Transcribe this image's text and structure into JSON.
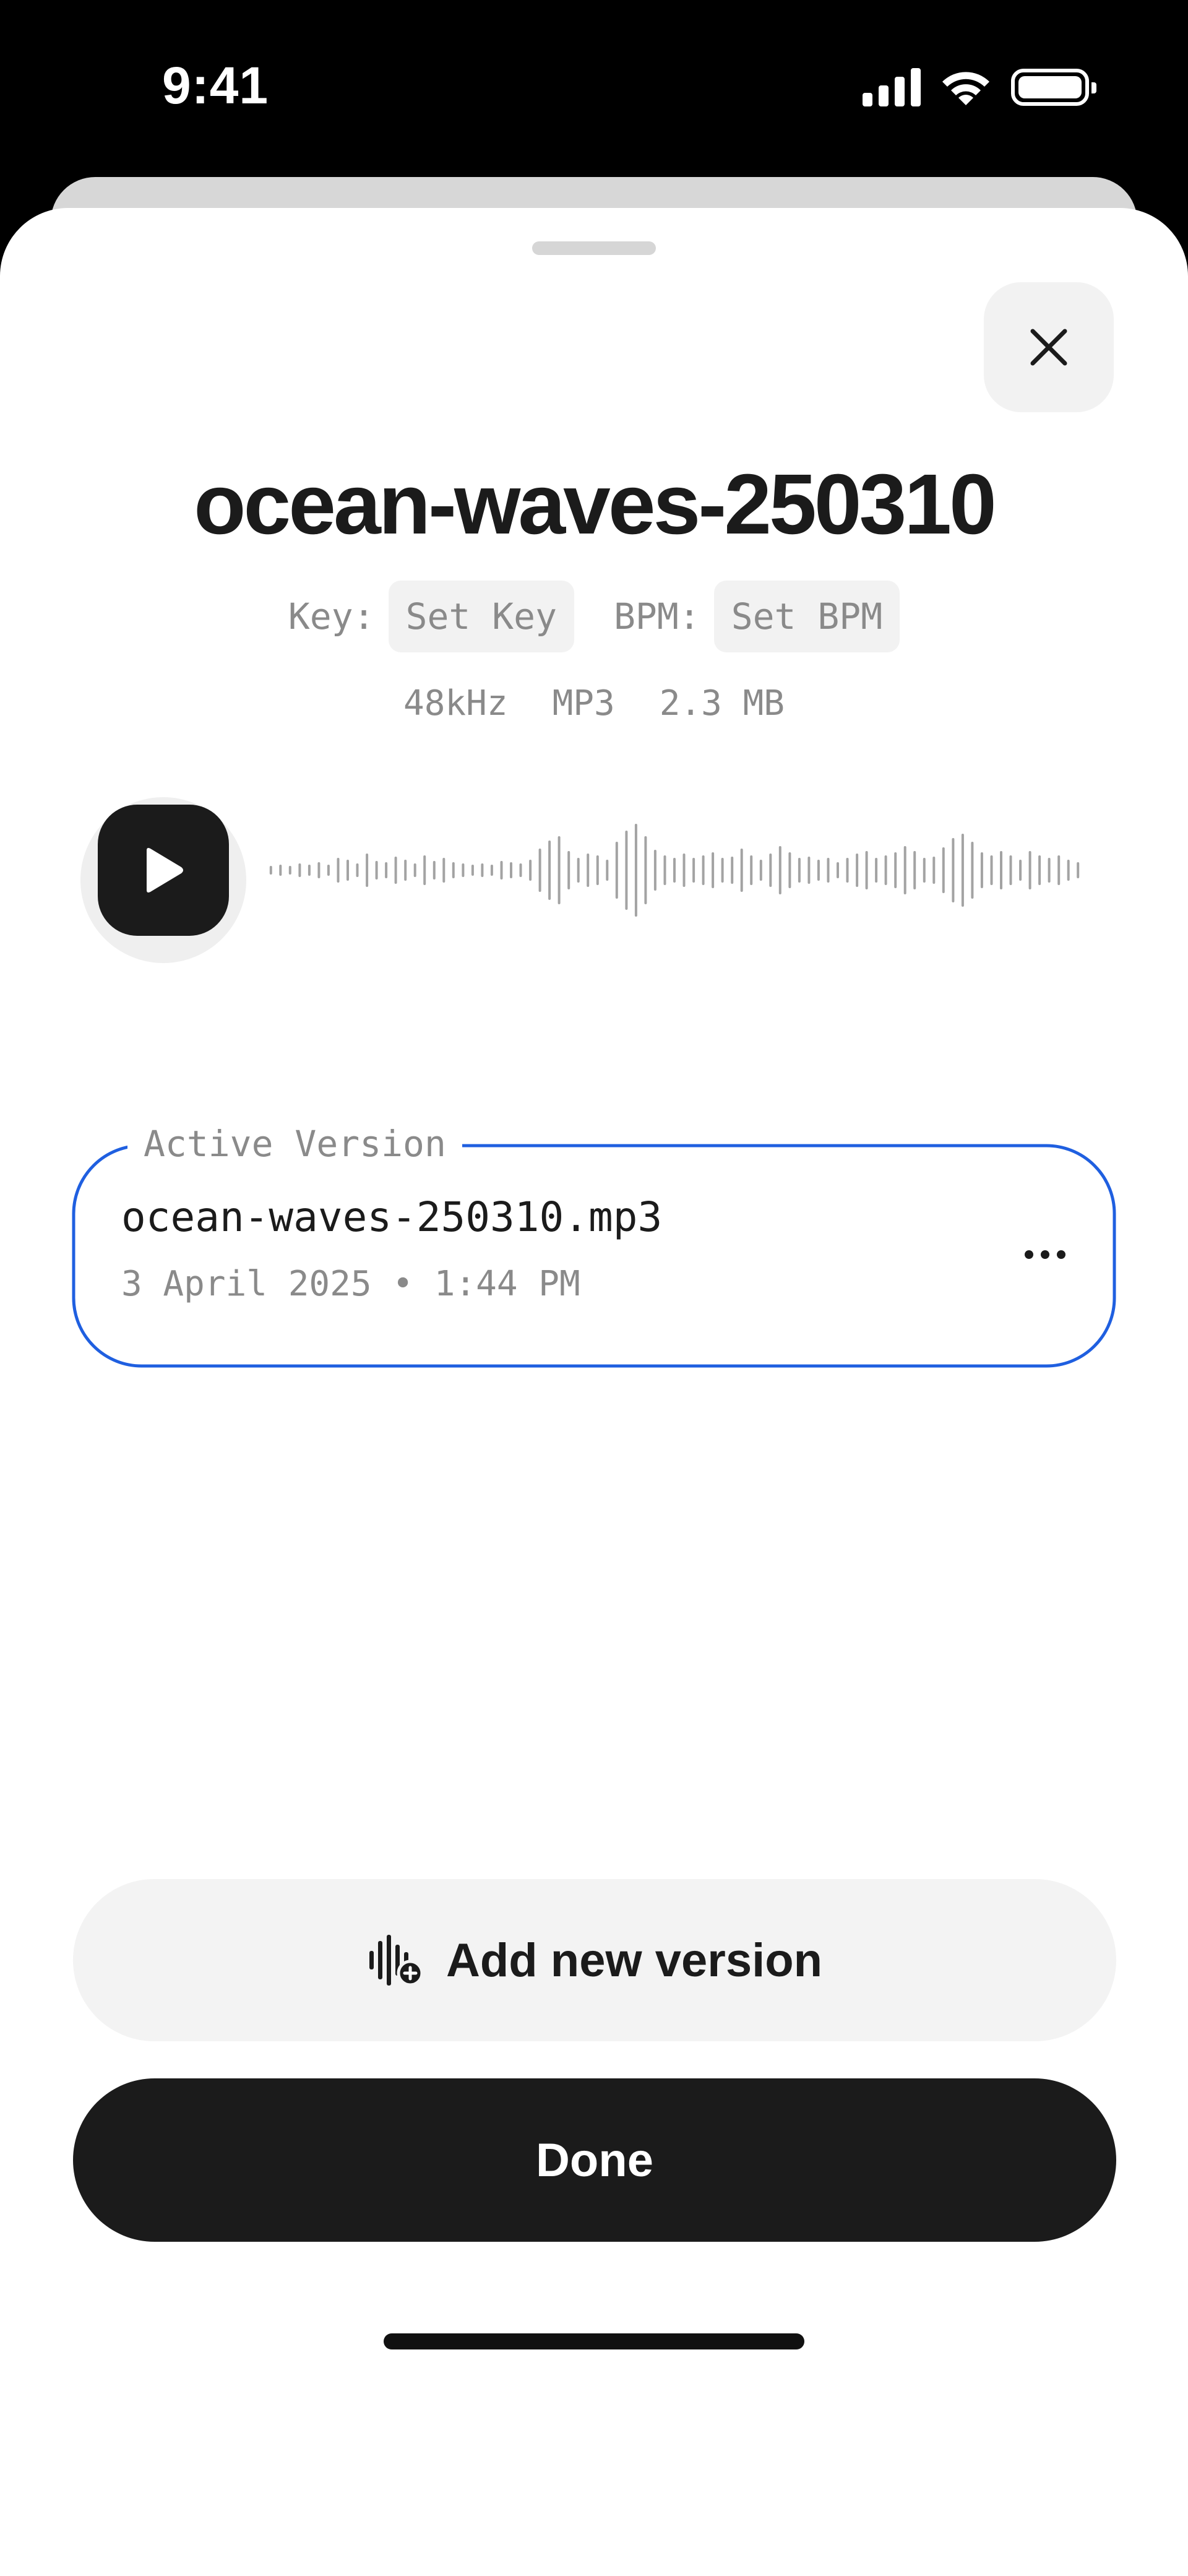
{
  "status_bar": {
    "time": "9:41",
    "icons": [
      "signal-icon",
      "wifi-icon",
      "battery-icon"
    ]
  },
  "sheet": {
    "title": "ocean-waves-250310",
    "close_icon": "close-icon",
    "key": {
      "label": "Key:",
      "value": "Set Key"
    },
    "bpm": {
      "label": "BPM:",
      "value": "Set BPM"
    },
    "format": {
      "sample_rate": "48kHz",
      "type": "MP3",
      "size": "2.3 MB"
    }
  },
  "player": {
    "play_icon": "play-icon",
    "waveform_icon": "waveform"
  },
  "active_version": {
    "legend": "Active Version",
    "file_name": "ocean-waves-250310.mp3",
    "date": "3 April 2025 • 1:44 PM",
    "more_icon": "more-icon"
  },
  "actions": {
    "add_new_version": "Add new version",
    "done": "Done"
  },
  "colors": {
    "accent_blue": "#1f5fe0",
    "primary_dark": "#1b1b1b",
    "muted_text": "#8a8a8a",
    "pill_bg": "#f2f2f2"
  }
}
